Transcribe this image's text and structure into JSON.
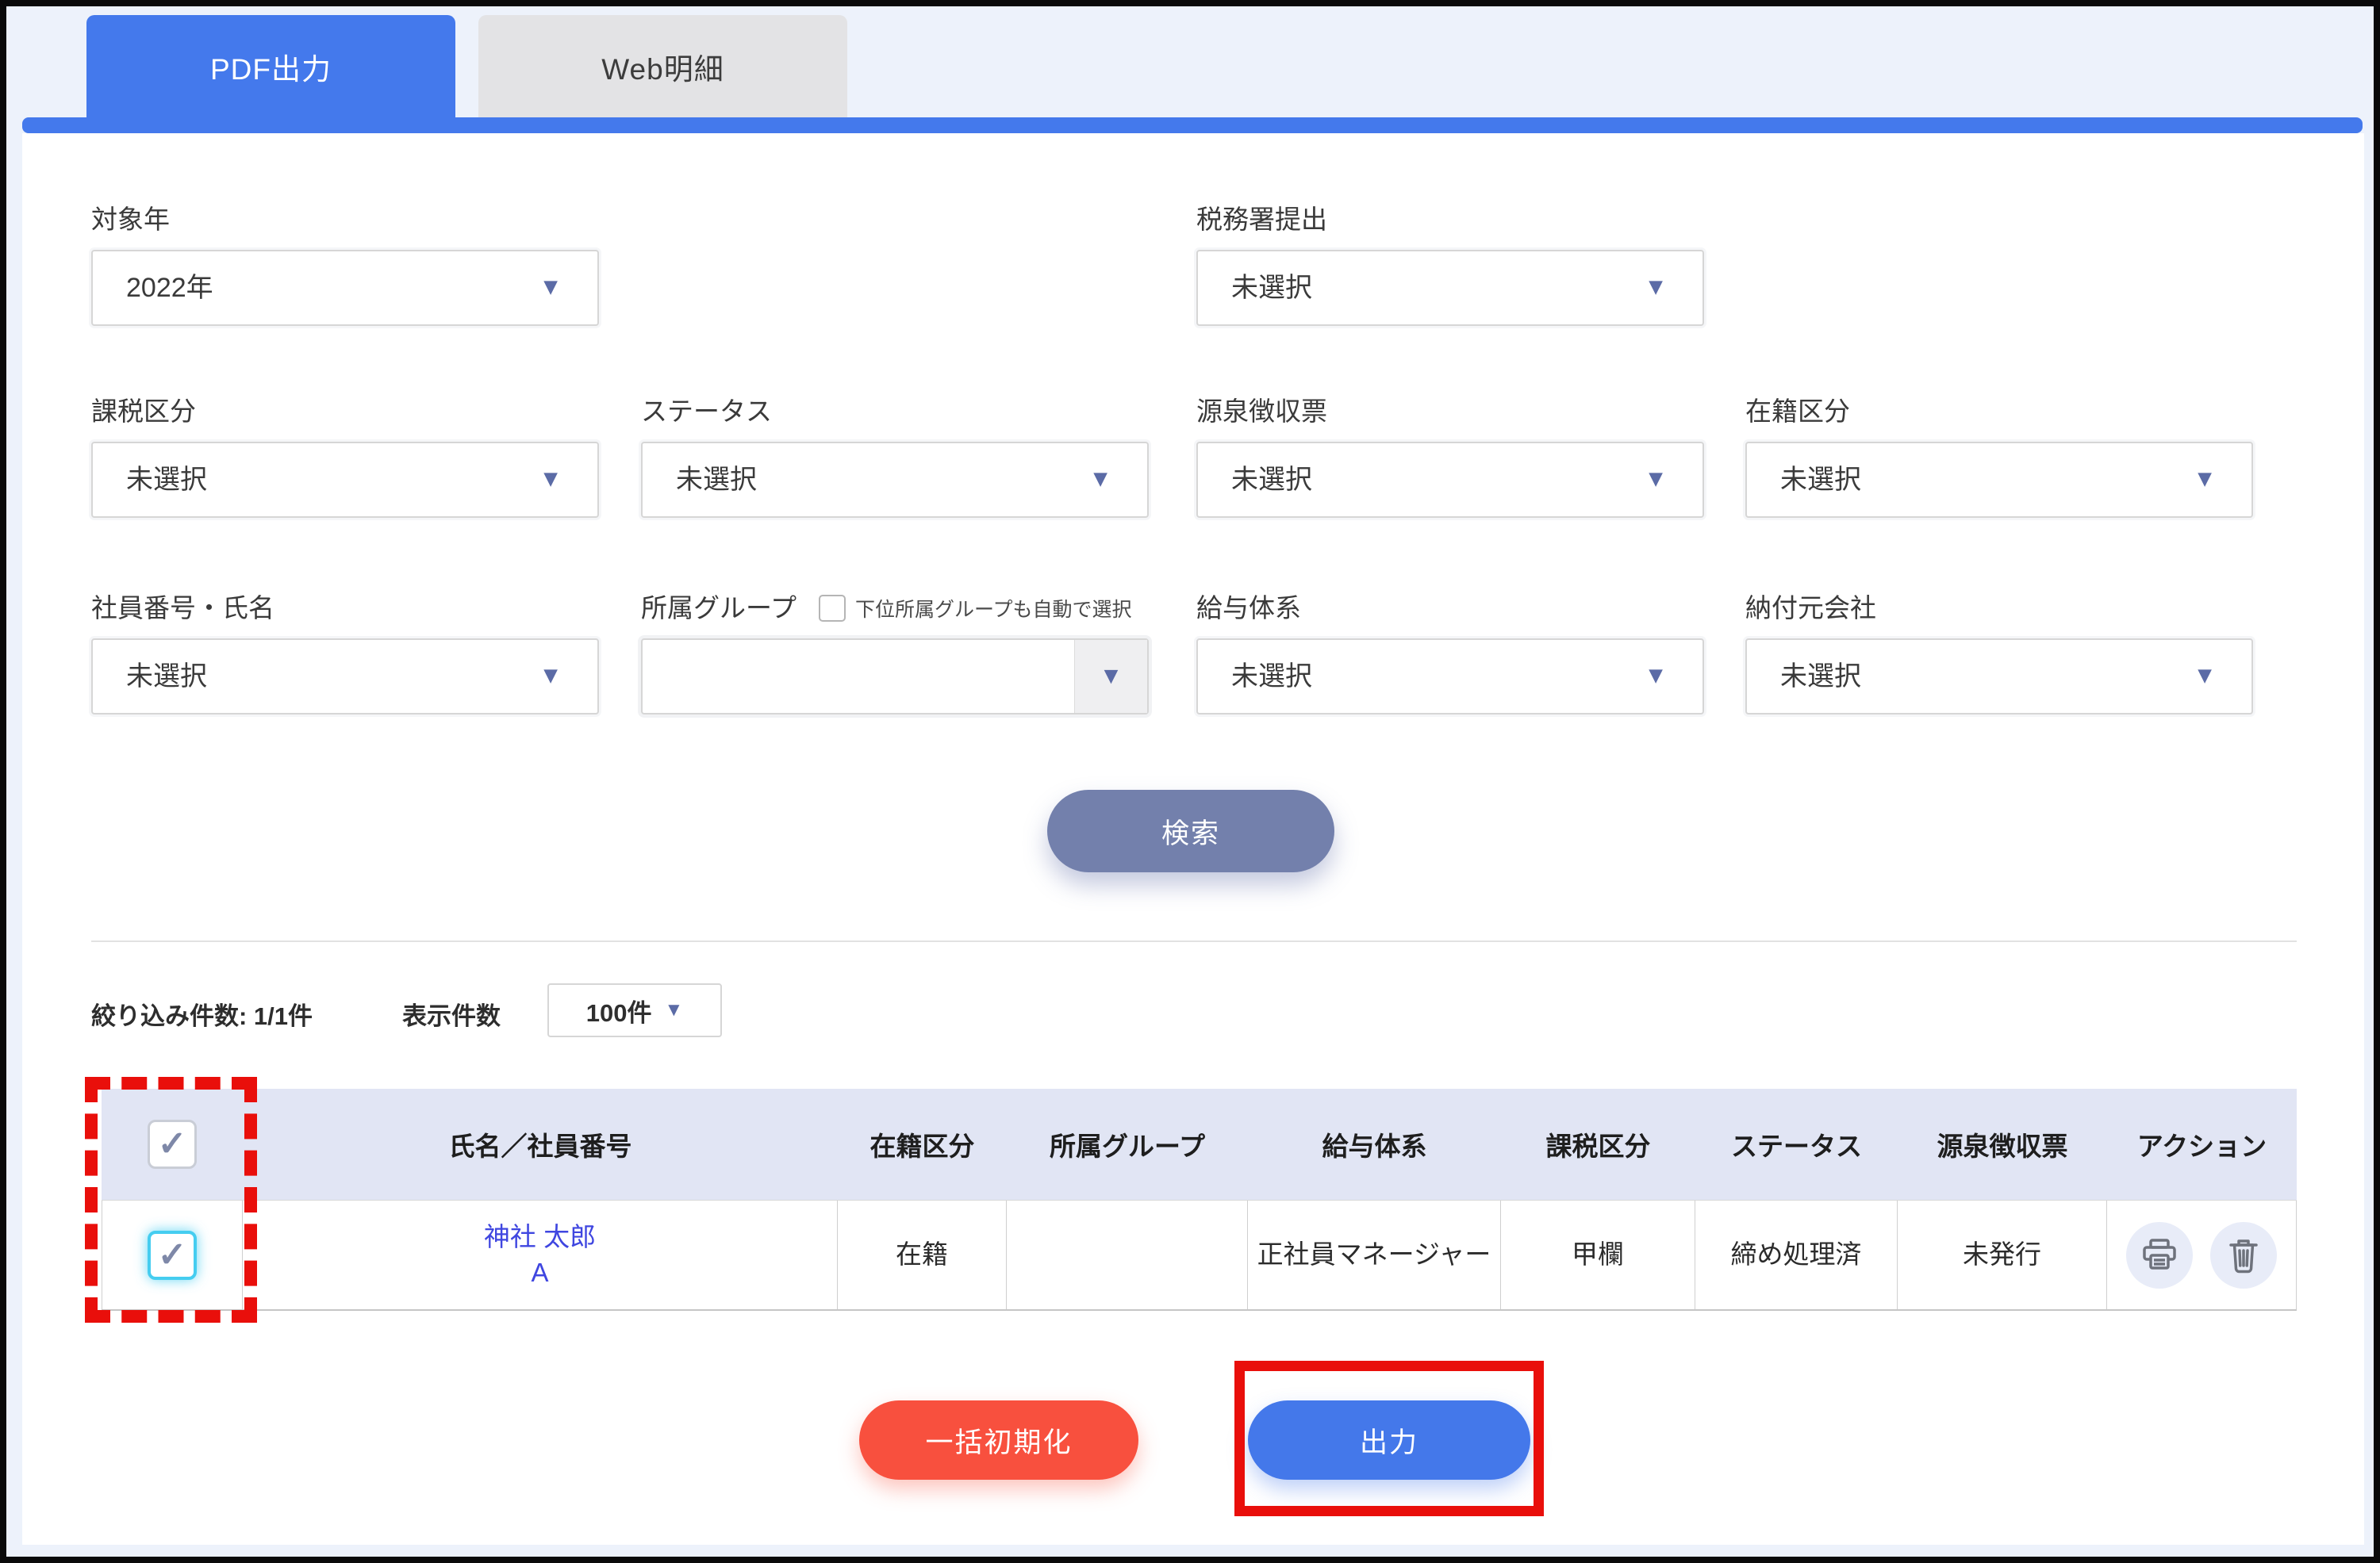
{
  "tabs": {
    "pdf": "PDF出力",
    "web": "Web明細"
  },
  "icons": {
    "dropdown_arrow": "▼",
    "check": "✓"
  },
  "filters": {
    "target_year": {
      "label": "対象年",
      "value": "2022年"
    },
    "tax_office_submission": {
      "label": "税務署提出",
      "value": "未選択"
    },
    "tax_category": {
      "label": "課税区分",
      "value": "未選択"
    },
    "status": {
      "label": "ステータス",
      "value": "未選択"
    },
    "withholding_slip": {
      "label": "源泉徴収票",
      "value": "未選択"
    },
    "enrollment_category": {
      "label": "在籍区分",
      "value": "未選択"
    },
    "employee_number_name": {
      "label": "社員番号・氏名",
      "value": "未選択"
    },
    "affiliation_group": {
      "label": "所属グループ",
      "value": "",
      "checkbox_label": "下位所属グループも自動で選択"
    },
    "salary_system": {
      "label": "給与体系",
      "value": "未選択"
    },
    "payment_source_company": {
      "label": "納付元会社",
      "value": "未選択"
    }
  },
  "search_button_label": "検索",
  "results": {
    "filtered_count": "絞り込み件数: 1/1件",
    "display_count_label": "表示件数",
    "page_size": "100件"
  },
  "table": {
    "headers": [
      "氏名／社員番号",
      "在籍区分",
      "所属グループ",
      "給与体系",
      "課税区分",
      "ステータス",
      "源泉徴収票",
      "アクション"
    ],
    "rows": [
      {
        "name": "神社 太郎",
        "employee_code": "A",
        "enrollment": "在籍",
        "group": "",
        "salary_system": "正社員マネージャー",
        "tax_category": "甲欄",
        "status": "締め処理済",
        "withholding_slip": "未発行"
      }
    ]
  },
  "footer": {
    "bulk_reset_label": "一括初期化",
    "export_label": "出力"
  },
  "colors": {
    "accent_blue": "#4479ec",
    "search_button": "#7380ac",
    "reset_red": "#f8503e",
    "export_blue": "#4478ea",
    "annotation_red": "#e90f0b",
    "header_lavender": "#e1e5f4",
    "link_blue": "#3f46e0",
    "checkbox_cyan": "#45cdf0"
  }
}
